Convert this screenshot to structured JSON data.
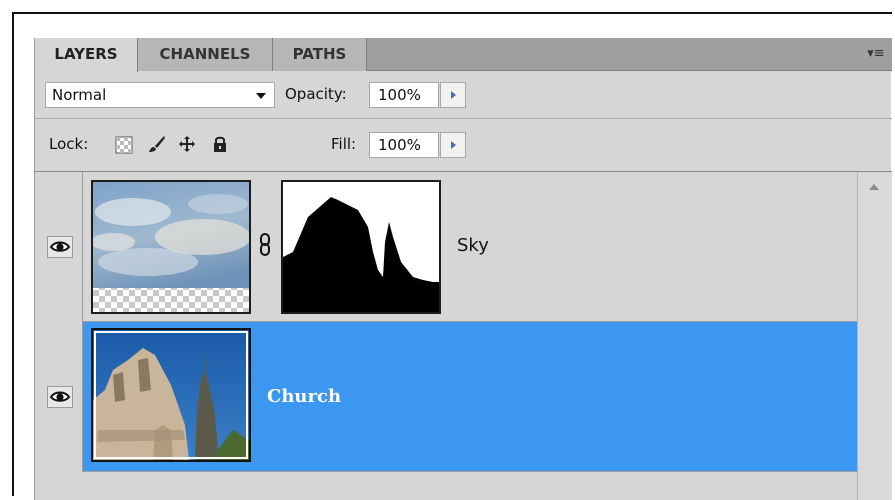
{
  "tabs": [
    {
      "label": "LAYERS",
      "active": true
    },
    {
      "label": "CHANNELS",
      "active": false
    },
    {
      "label": "PATHS",
      "active": false
    }
  ],
  "panel_menu_icon": "panel-menu-icon",
  "blend_mode": {
    "value": "Normal"
  },
  "opacity": {
    "label": "Opacity:",
    "value": "100%"
  },
  "lock": {
    "label": "Lock:",
    "icons": [
      "lock-transparent-pixels-icon",
      "lock-image-pixels-icon",
      "lock-position-icon",
      "lock-all-icon"
    ]
  },
  "fill": {
    "label": "Fill:",
    "value": "100%"
  },
  "layers": [
    {
      "name": "Sky",
      "visible": true,
      "selected": false,
      "has_mask": true
    },
    {
      "name": "Church",
      "visible": true,
      "selected": true,
      "has_mask": false
    }
  ],
  "colors": {
    "selection": "#3c97f0",
    "panel_bg": "#d6d6d6",
    "tab_bar": "#9f9f9f"
  }
}
